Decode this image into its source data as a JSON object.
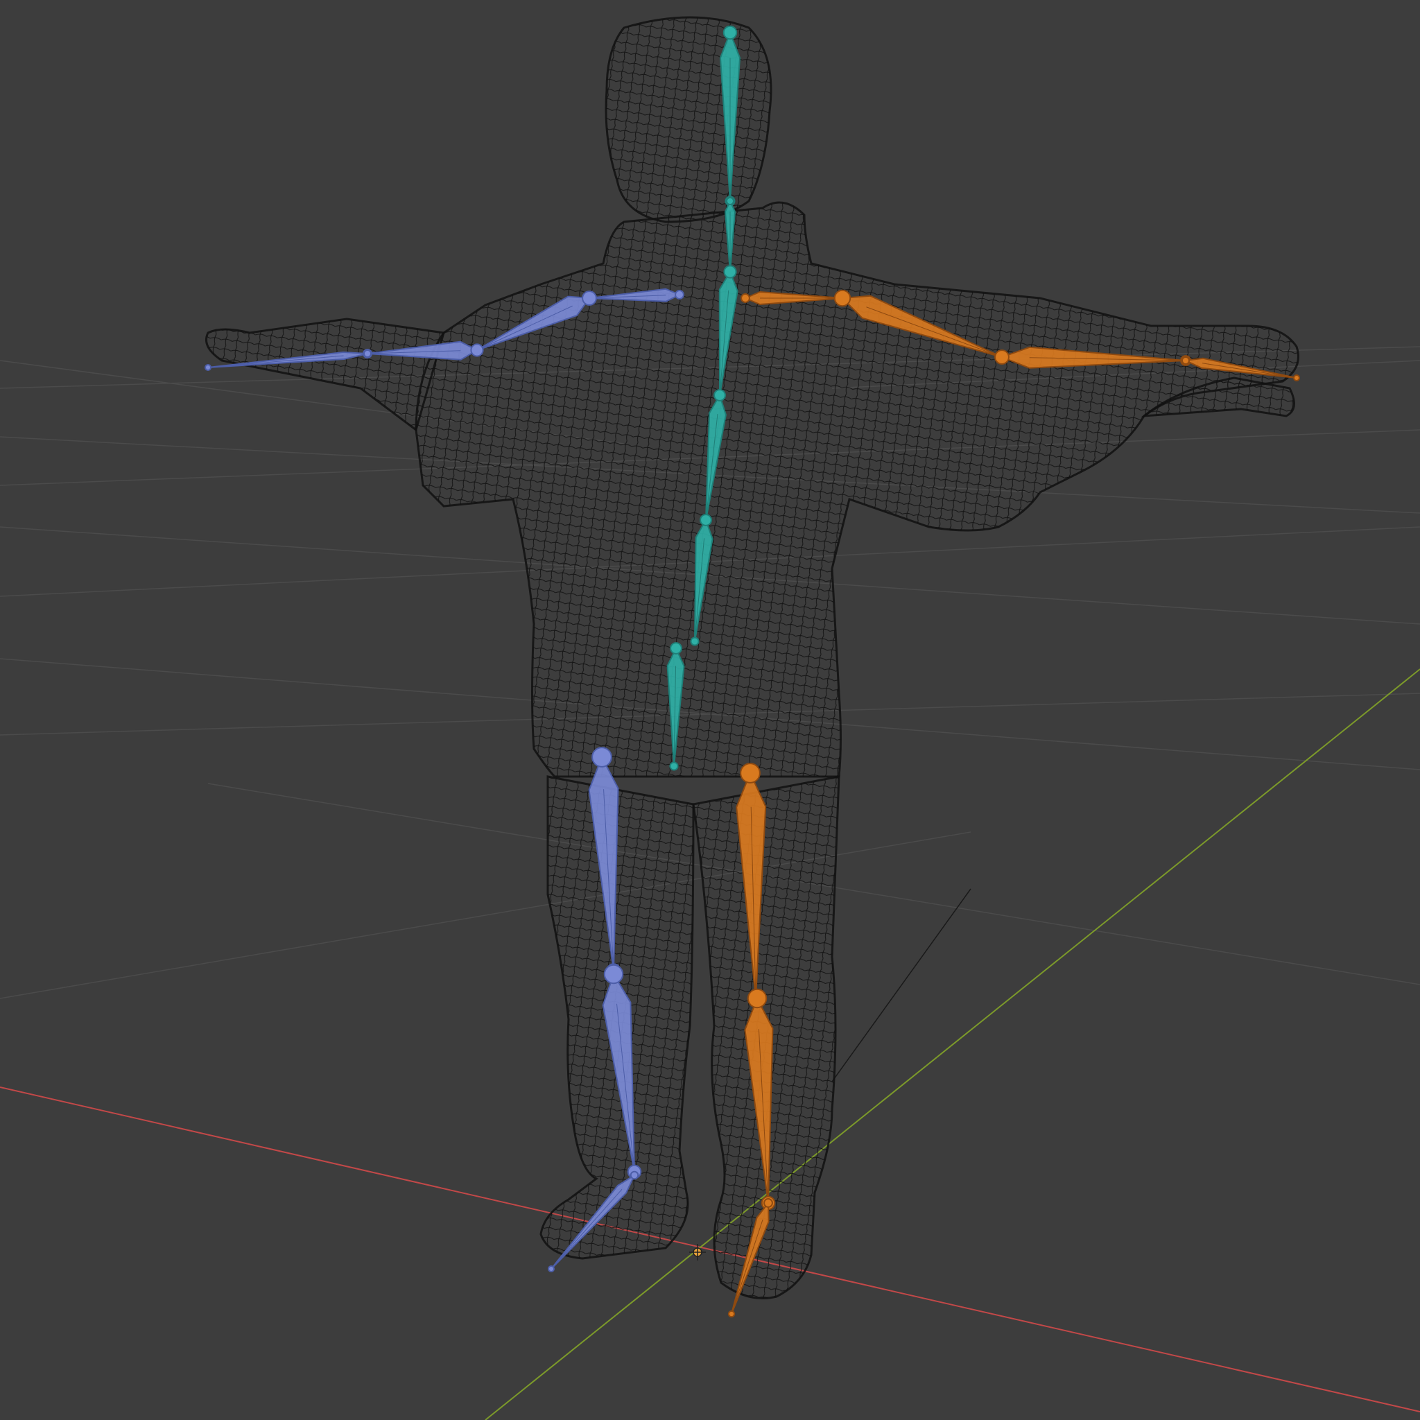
{
  "viewport": {
    "background": "#3d3d3d",
    "grid_color": "#4b4b4b",
    "axis_x_color": "#c24848",
    "axis_y_color": "#7c9a2a",
    "mesh_color": "#111111",
    "view_axis_color": "#1a1a1a"
  },
  "armature": {
    "spine_color": "#2fb0a6",
    "spine_edge": "#1f7f78",
    "right_side_color": "#7b8ad6",
    "right_side_edge": "#4d5ea8",
    "left_side_color": "#d97a1f",
    "left_side_edge": "#8f4a10",
    "bones": [
      {
        "name": "head",
        "side": "spine"
      },
      {
        "name": "neck",
        "side": "spine"
      },
      {
        "name": "chest",
        "side": "spine"
      },
      {
        "name": "spine-upper",
        "side": "spine"
      },
      {
        "name": "spine-mid",
        "side": "spine"
      },
      {
        "name": "spine-lower",
        "side": "spine"
      },
      {
        "name": "shoulder-r",
        "side": "right"
      },
      {
        "name": "upperarm-r",
        "side": "right"
      },
      {
        "name": "forearm-r",
        "side": "right"
      },
      {
        "name": "hand-r",
        "side": "right"
      },
      {
        "name": "shoulder-l",
        "side": "left"
      },
      {
        "name": "upperarm-l",
        "side": "left"
      },
      {
        "name": "forearm-l",
        "side": "left"
      },
      {
        "name": "hand-l",
        "side": "left"
      },
      {
        "name": "thigh-r",
        "side": "right"
      },
      {
        "name": "shin-r",
        "side": "right"
      },
      {
        "name": "foot-r",
        "side": "right"
      },
      {
        "name": "thigh-l",
        "side": "left"
      },
      {
        "name": "shin-l",
        "side": "left"
      },
      {
        "name": "foot-l",
        "side": "left"
      }
    ]
  },
  "object_origin": {
    "icon": "origin-crosshair-icon"
  }
}
